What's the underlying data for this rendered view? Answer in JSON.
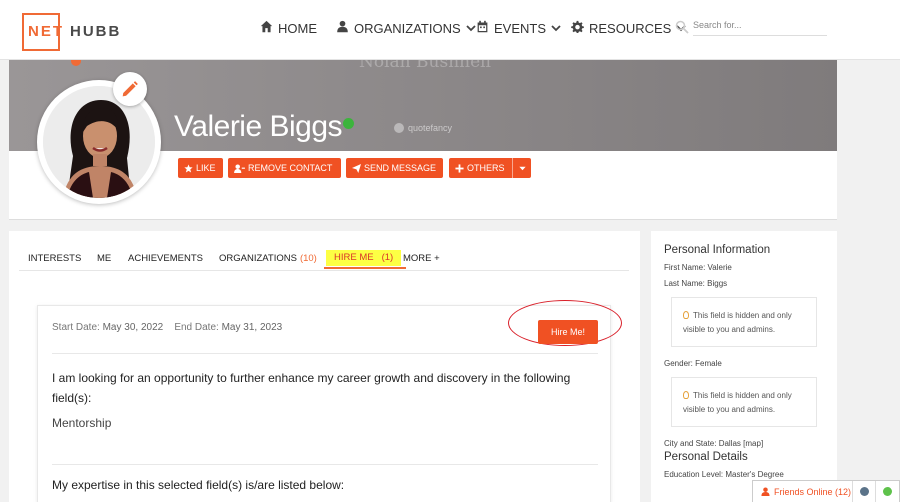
{
  "brand": {
    "logo_net": "NET",
    "logo_hubb": "HUBB"
  },
  "nav": {
    "items": [
      {
        "label": "HOME",
        "icon": "home-icon"
      },
      {
        "label": "ORGANIZATIONS",
        "icon": "user-icon"
      },
      {
        "label": "EVENTS",
        "icon": "calendar-icon"
      },
      {
        "label": "RESOURCES",
        "icon": "gear-icon"
      }
    ],
    "search_placeholder": "Search for..."
  },
  "profile": {
    "cover_quote": "Nolan Bushnell",
    "cover_brand": "quotefancy",
    "name": "Valerie Biggs",
    "verified": true,
    "actions": {
      "like": "LIKE",
      "remove_contact": "REMOVE CONTACT",
      "send_message": "SEND MESSAGE",
      "others": "OTHERS"
    }
  },
  "tabs": {
    "interests": "INTERESTS",
    "me": "ME",
    "achievements": "ACHIEVEMENTS",
    "organizations": "ORGANIZATIONS",
    "organizations_count": "(10)",
    "hire_me": "HIRE ME",
    "hire_me_count": "(1)",
    "more": "MORE +"
  },
  "hire": {
    "start_label": "Start Date:",
    "start_value": "May 30, 2022",
    "end_label": "End Date:",
    "end_value": "May 31, 2023",
    "button": "Hire Me!",
    "lead": "I am looking for an opportunity to further enhance my career growth and discovery in the following field(s):",
    "field": "Mentorship",
    "expertise_lead": "My expertise in this selected field(s) is/are listed below:"
  },
  "sidebar": {
    "personal_info_title": "Personal Information",
    "first_name": "First Name: Valerie",
    "last_name": "Last Name: Biggs",
    "hidden_note": "This field is hidden and only visible to you and admins.",
    "gender": "Gender: Female",
    "hidden_note2": "This field is hidden and only visible to you and admins.",
    "city_state": "City and State: Dallas",
    "map_link": "[map]",
    "personal_details_title": "Personal Details",
    "education": "Education Level: Master's Degree"
  },
  "friends": {
    "label": "Friends Online (12)"
  },
  "colors": {
    "accent": "#f05123",
    "logo": "#f06a35",
    "highlight": "#fdff44",
    "verified": "#3cb43c"
  }
}
